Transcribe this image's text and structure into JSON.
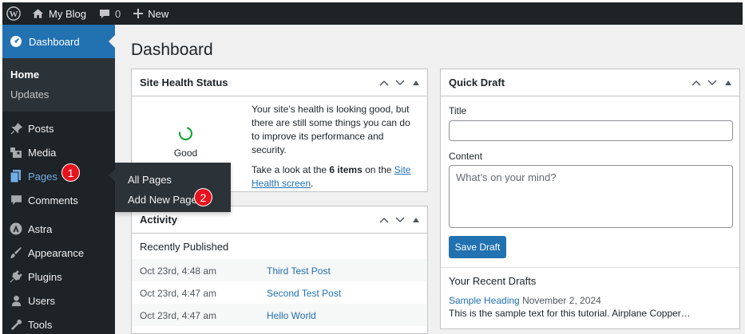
{
  "admin_bar": {
    "site_name": "My Blog",
    "comments_count": "0",
    "new_label": "New"
  },
  "sidebar": {
    "dashboard_label": "Dashboard",
    "submenu": [
      "Home",
      "Updates"
    ],
    "items": [
      {
        "label": "Posts",
        "icon": "pin-icon"
      },
      {
        "label": "Media",
        "icon": "media-icon"
      },
      {
        "label": "Pages",
        "icon": "pages-icon"
      },
      {
        "label": "Comments",
        "icon": "comment-icon"
      },
      {
        "label": "Astra",
        "icon": "astra-icon"
      },
      {
        "label": "Appearance",
        "icon": "brush-icon"
      },
      {
        "label": "Plugins",
        "icon": "plugin-icon"
      },
      {
        "label": "Users",
        "icon": "users-icon"
      },
      {
        "label": "Tools",
        "icon": "wrench-icon"
      }
    ]
  },
  "flyout": {
    "items": [
      "All Pages",
      "Add New Page"
    ]
  },
  "annotations": {
    "step1": "1",
    "step2": "2"
  },
  "page": {
    "title": "Dashboard"
  },
  "site_health": {
    "title": "Site Health Status",
    "status": "Good",
    "text1": "Your site’s health is looking good, but there are still some things you can do to improve its performance and security.",
    "text2_prefix": "Take a look at the ",
    "text2_bold": "6 items",
    "text2_mid": " on the ",
    "text2_link": "Site Health screen",
    "text2_suffix": "."
  },
  "activity": {
    "title": "Activity",
    "subtitle": "Recently Published",
    "rows": [
      {
        "date": "Oct 23rd, 4:48 am",
        "title": "Third Test Post"
      },
      {
        "date": "Oct 23rd, 4:47 am",
        "title": "Second Test Post"
      },
      {
        "date": "Oct 23rd, 4:47 am",
        "title": "Hello World"
      }
    ]
  },
  "quick_draft": {
    "title": "Quick Draft",
    "title_label": "Title",
    "content_label": "Content",
    "content_placeholder": "What’s on your mind?",
    "save_label": "Save Draft",
    "recent_heading": "Your Recent Drafts",
    "draft_link": "Sample Heading",
    "draft_date": "November 2, 2024",
    "draft_excerpt": "This is the sample text for this tutorial. Airplane Copper…"
  },
  "colors": {
    "admin_dark": "#1d2327",
    "accent": "#2271b1",
    "badge_red": "#e8121d",
    "health_green": "#00a32a"
  }
}
